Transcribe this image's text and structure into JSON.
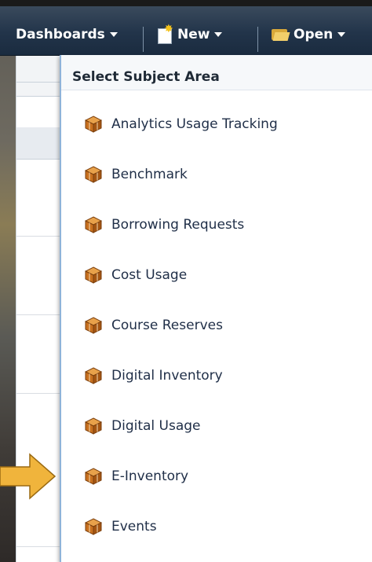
{
  "toolbar": {
    "dashboards_label": "Dashboards",
    "new_label": "New",
    "open_label": "Open"
  },
  "menu": {
    "title": "Select Subject Area",
    "items": [
      {
        "label": "Analytics Usage Tracking",
        "icon": "subject-area-cube-icon"
      },
      {
        "label": "Benchmark",
        "icon": "subject-area-cube-icon"
      },
      {
        "label": "Borrowing Requests",
        "icon": "subject-area-cube-icon"
      },
      {
        "label": "Cost Usage",
        "icon": "subject-area-cube-icon"
      },
      {
        "label": "Course Reserves",
        "icon": "subject-area-cube-icon"
      },
      {
        "label": "Digital Inventory",
        "icon": "subject-area-cube-icon"
      },
      {
        "label": "Digital Usage",
        "icon": "subject-area-cube-icon"
      },
      {
        "label": "E-Inventory",
        "icon": "subject-area-cube-icon"
      },
      {
        "label": "Events",
        "icon": "subject-area-cube-icon"
      }
    ],
    "highlighted_item": "E-Inventory"
  },
  "colors": {
    "header_bg": "#22344a",
    "menu_text": "#1f2e47",
    "cube_orange": "#c9711f",
    "arrow": "#f0b43c"
  }
}
